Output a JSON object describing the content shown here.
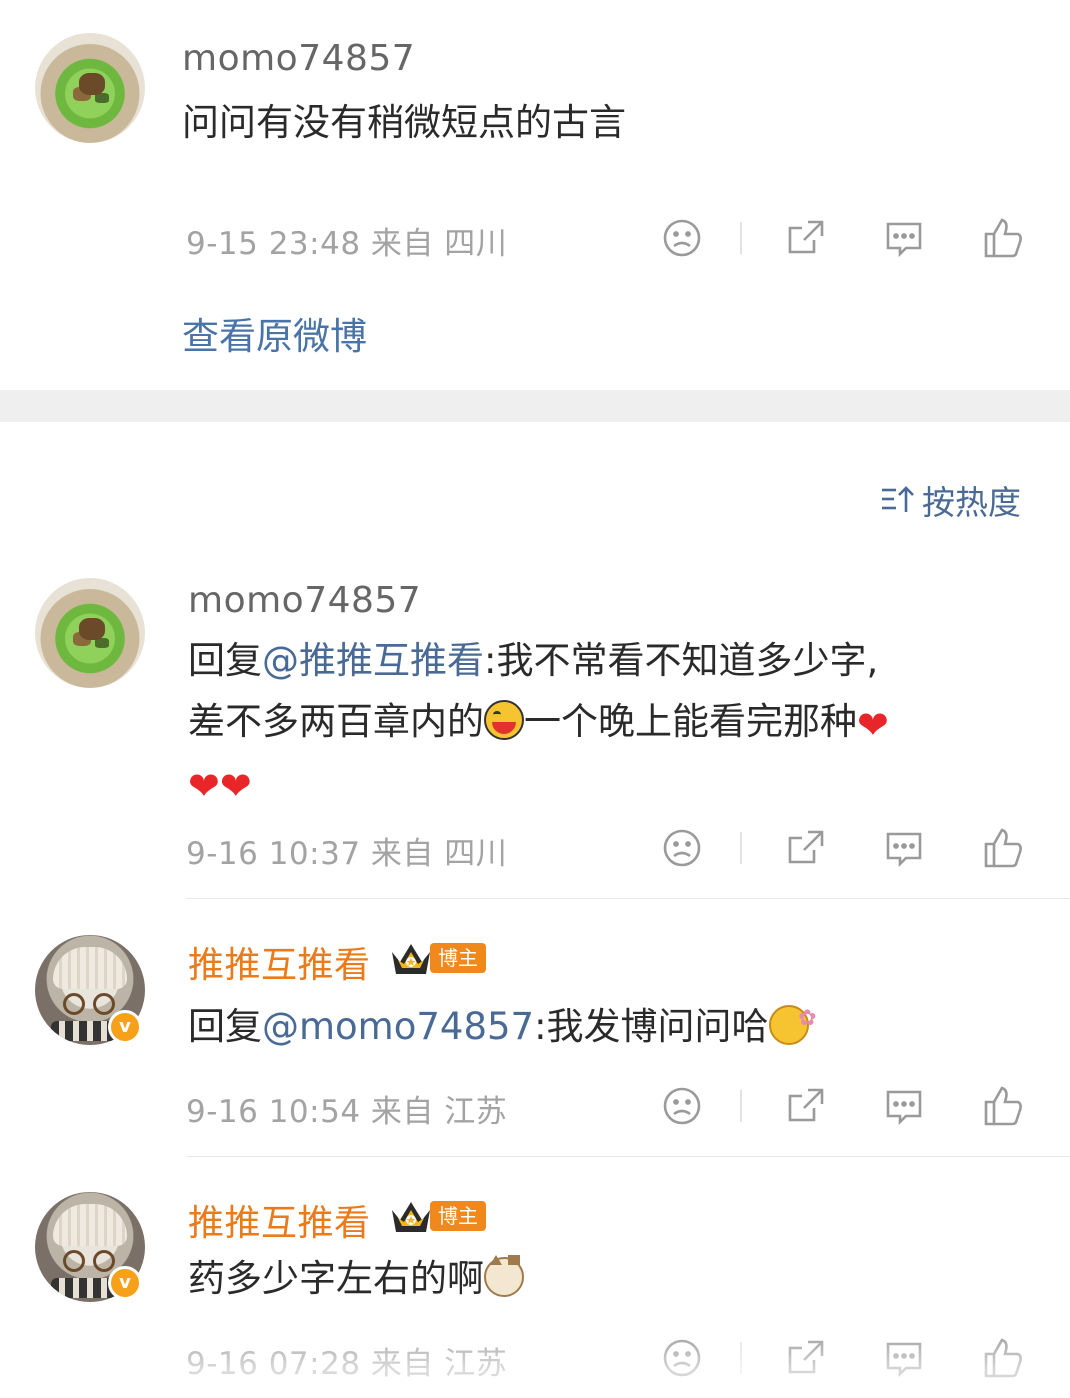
{
  "post": {
    "author": "momo74857",
    "text": "问问有没有稍微短点的古言",
    "meta": "9-15 23:48 来自 四川",
    "view_original": "查看原微博"
  },
  "sort": {
    "label": "按热度"
  },
  "comments": [
    {
      "author": "momo74857",
      "reply_prefix": "回复",
      "mention": "@推推互推看",
      "text_a": ":我不常看不知道多少字,",
      "text_b": "差不多两百章内的",
      "text_c": "一个晚上能看完那种",
      "meta": "9-16 10:37 来自 四川"
    },
    {
      "author": "推推互推看",
      "badge": "博主",
      "reply_prefix": "回复",
      "mention": "@momo74857",
      "text": ":我发博问问哈",
      "meta": "9-16 10:54 来自 江苏"
    },
    {
      "author": "推推互推看",
      "badge": "博主",
      "text": "药多少字左右的啊",
      "meta": "9-16 07:28 来自 江苏"
    }
  ],
  "icons": {
    "dislike": "sad-face-icon",
    "share": "share-icon",
    "comment": "comment-icon",
    "like": "thumbs-up-icon"
  },
  "colors": {
    "mention": "#4a6a96",
    "vip_name": "#ea7a1a",
    "meta": "#a3a3a3",
    "heart": "#e8262a"
  }
}
